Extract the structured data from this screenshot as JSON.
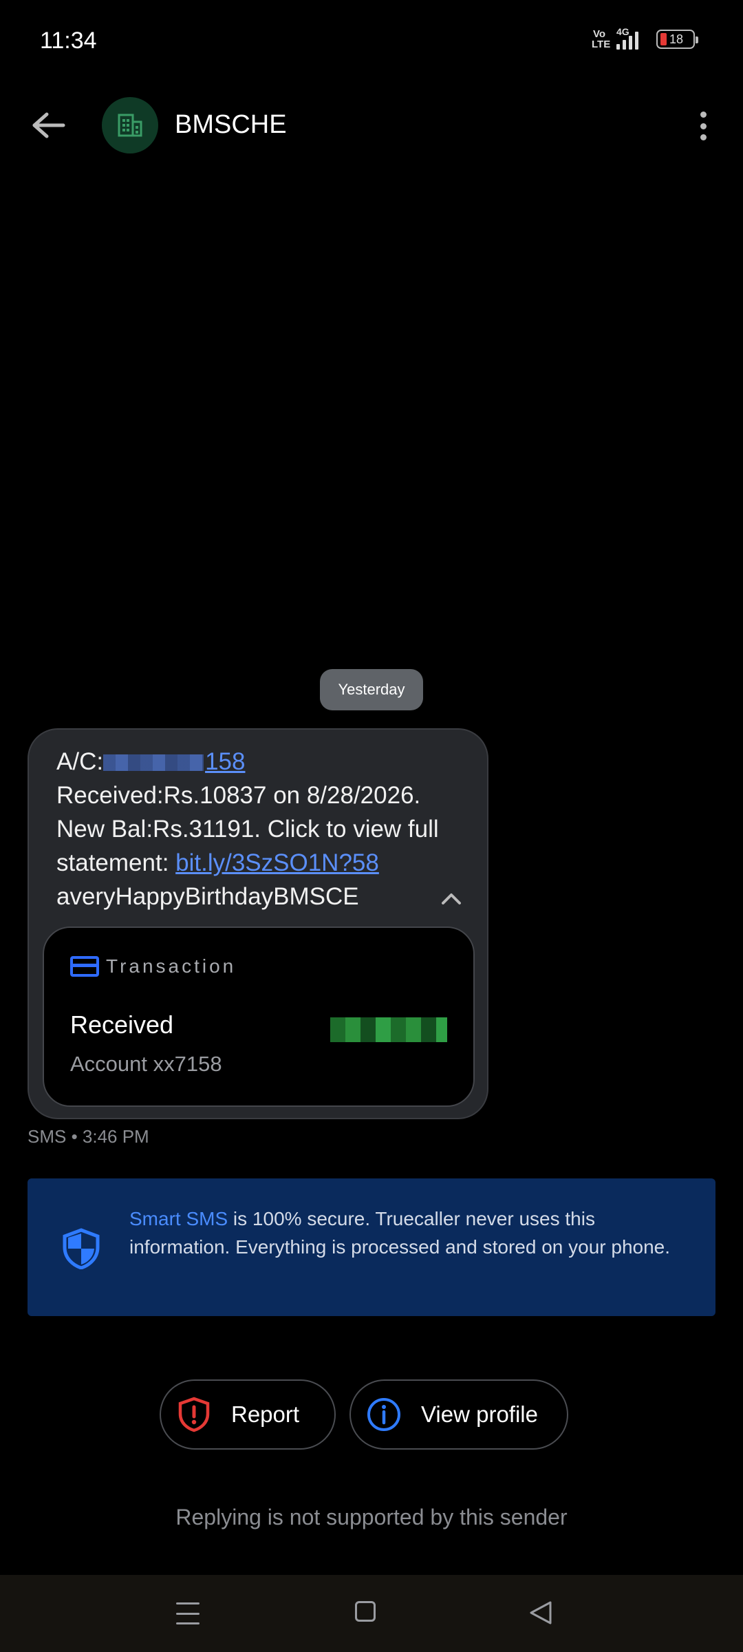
{
  "status_bar": {
    "time": "11:34",
    "volte": "Vo LTE",
    "network": "4G",
    "battery": "18"
  },
  "header": {
    "sender": "BMSCHE",
    "avatar_icon": "building-icon",
    "back_icon": "arrow-left-icon",
    "menu_icon": "more-vert-icon"
  },
  "conversation": {
    "date_label": "Yesterday",
    "message": {
      "ac_prefix": "A/C:",
      "ac_number_visible": "158",
      "line2": "Received:Rs.10837 on 8/28/2026.",
      "line3": "New Bal:Rs.31191. Click to view full",
      "statement_prefix": "statement: ",
      "statement_link": "bit.ly/3SzSO1N?58",
      "line5": "averyHappyBirthdayBMSCE"
    },
    "transaction_card": {
      "title": "Transaction",
      "status": "Received",
      "account": "Account xx7158"
    },
    "meta": "SMS • 3:46 PM"
  },
  "info_box": {
    "brand": "Smart SMS",
    "text": " is 100% secure. Truecaller never uses this information. Everything is processed and stored on your phone."
  },
  "actions": {
    "report_label": "Report",
    "profile_label": "View profile"
  },
  "footer_note": "Replying is not supported by this sender",
  "colors": {
    "accent_blue": "#2f6bff",
    "info_bg": "#0a2a5c",
    "bubble_bg": "#26282c",
    "report_red": "#e53935"
  }
}
